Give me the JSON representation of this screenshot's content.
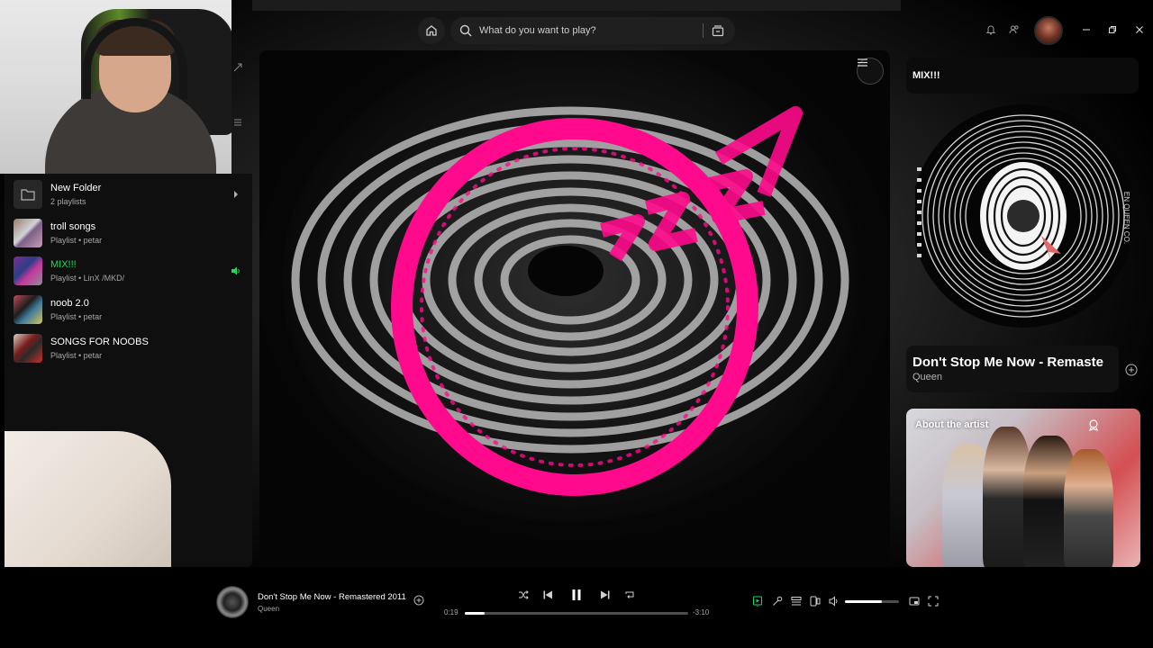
{
  "colors": {
    "accent": "#1ed760",
    "viz_pink": "#ff0a8c",
    "panel": "#0f0f0f"
  },
  "topbar": {
    "search_placeholder": "What do you want to play?",
    "icons": [
      "home-icon",
      "search-icon",
      "browse-icon",
      "bell-icon",
      "friends-icon",
      "avatar",
      "minimize-icon",
      "maximize-icon",
      "close-icon"
    ]
  },
  "library": {
    "items": [
      {
        "title": "New Folder",
        "subtitle": "2 playlists",
        "type": "folder"
      },
      {
        "title": "troll songs",
        "subtitle": "Playlist • petar",
        "type": "playlist"
      },
      {
        "title": "MIX!!!",
        "subtitle": "Playlist • LinX /MKD/",
        "type": "playlist",
        "active": true
      },
      {
        "title": "noob 2.0",
        "subtitle": "Playlist • petar",
        "type": "playlist"
      },
      {
        "title": "SONGS FOR NOOBS",
        "subtitle": "Playlist • petar",
        "type": "playlist"
      }
    ]
  },
  "right_panel": {
    "header": "MIX!!!",
    "now_playing_title": "Don't Stop Me Now - Remaste",
    "now_playing_artist": "Queen",
    "about_title": "About the artist",
    "disc_text": "EN QUEEN CO."
  },
  "player": {
    "track_title": "Don't Stop Me Now - Remastered 2011",
    "artist": "Queen",
    "elapsed": "0:19",
    "remaining": "-3:10",
    "progress_fraction": 0.09,
    "volume_fraction": 0.68,
    "is_playing": true
  }
}
